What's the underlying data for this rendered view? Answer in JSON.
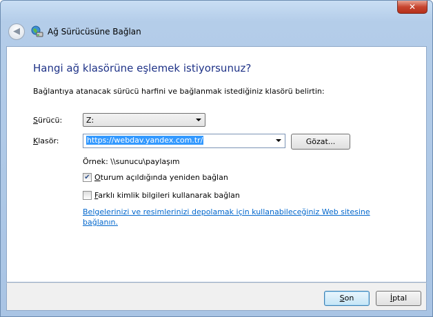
{
  "window": {
    "close_label": "✕"
  },
  "header": {
    "title": "Ağ Sürücüsüne Bağlan",
    "back_glyph": "◀"
  },
  "main": {
    "heading": "Hangi ağ klasörüne eşlemek istiyorsunuz?",
    "description": "Bağlantıya atanacak sürücü harfini ve bağlanmak istediğiniz klasörü belirtin:",
    "drive": {
      "label_accel": "S",
      "label_rest": "ürücü:",
      "value": "Z:"
    },
    "folder": {
      "label_accel": "K",
      "label_rest": "lasör:",
      "value": "https://webdav.yandex.com.tr/"
    },
    "browse_label": "Gözat...",
    "example": "Örnek: \\\\sunucu\\paylaşım",
    "reconnect": {
      "checked": true,
      "check_glyph": "✔",
      "accel": "O",
      "rest": "turum açıldığında yeniden bağlan"
    },
    "other_credentials": {
      "checked": false,
      "accel": "F",
      "rest": "arklı kimlik bilgileri kullanarak bağlan"
    },
    "link": "Belgelerinizi ve resimlerinizi depolamak için kullanabileceğiniz Web sitesine bağlanın."
  },
  "footer": {
    "finish": {
      "accel": "S",
      "rest": "on"
    },
    "cancel": {
      "accel": "İ",
      "rest": "ptal"
    }
  },
  "colors": {
    "heading": "#1e3287",
    "link": "#0066cc",
    "selection": "#3399ff",
    "close": "#c7452f"
  }
}
